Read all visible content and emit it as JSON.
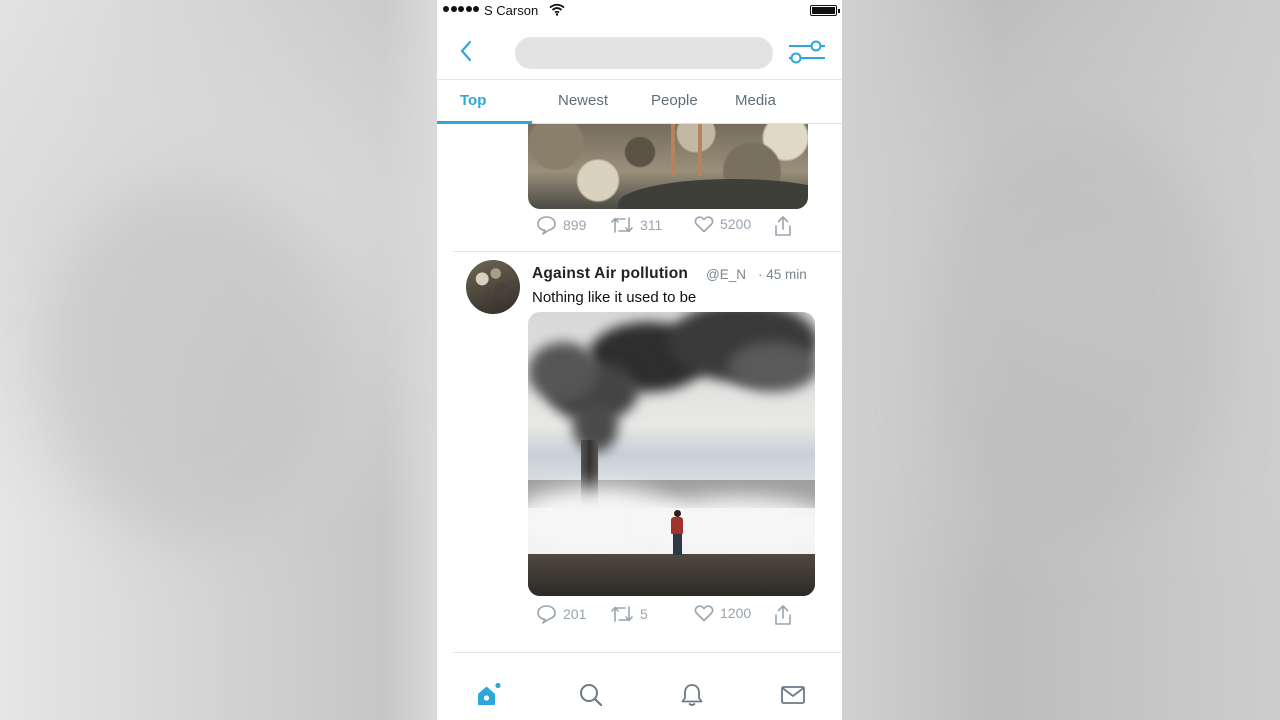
{
  "status_bar": {
    "carrier": "S Carson"
  },
  "header": {
    "search_placeholder": ""
  },
  "tabs": [
    {
      "label": "Top"
    },
    {
      "label": "Newest"
    },
    {
      "label": "People"
    },
    {
      "label": "Media"
    }
  ],
  "colors": {
    "accent": "#2ea6da",
    "muted": "#9aa4ad"
  },
  "tweets": [
    {
      "replies": "899",
      "retweets": "311",
      "likes": "5200"
    },
    {
      "name": "Against Air pollution",
      "handle": "@E_N",
      "time": "45 min",
      "text": "Nothing like it used to be",
      "replies": "201",
      "retweets": "5",
      "likes": "1200"
    }
  ],
  "tabbar": {
    "icons": [
      "home-icon",
      "search-icon",
      "bell-icon",
      "mail-icon"
    ]
  }
}
